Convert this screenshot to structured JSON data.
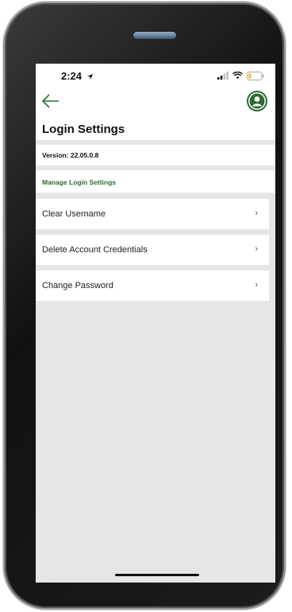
{
  "status_bar": {
    "time": "2:24",
    "location_icon": "location-arrow-icon",
    "signal_icon": "cellular-signal-icon",
    "wifi_icon": "wifi-icon",
    "battery_icon": "battery-low-icon",
    "battery_color": "#f3c84b"
  },
  "header": {
    "back_icon": "back-arrow-icon",
    "profile_icon": "user-profile-icon",
    "title": "Login Settings"
  },
  "version": {
    "label": "Version: 22.05.0.8"
  },
  "section": {
    "title": "Manage Login Settings",
    "color": "#2e6b34"
  },
  "menu": {
    "items": [
      {
        "label": "Clear Username",
        "chevron": "›"
      },
      {
        "label": "Delete Account Credentials",
        "chevron": "›"
      },
      {
        "label": "Change Password",
        "chevron": "›"
      }
    ]
  },
  "colors": {
    "accent": "#2e6b34",
    "screen_background": "#e6e6e6",
    "card_background": "#ffffff"
  }
}
